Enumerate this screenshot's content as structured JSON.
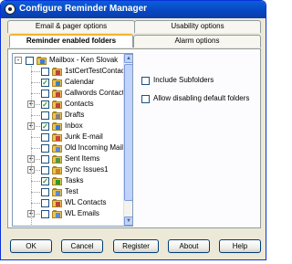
{
  "window": {
    "title": "Configure Reminder Manager",
    "titlebar_color": "#0a53d0"
  },
  "tabs": {
    "row_back": [
      {
        "label": "Email & pager options"
      },
      {
        "label": "Usability options"
      }
    ],
    "row_front": [
      {
        "label": "Reminder enabled folders",
        "active": true
      },
      {
        "label": "Alarm options",
        "active": false
      }
    ]
  },
  "tree": {
    "nodes": [
      {
        "label": "Mailbox - Ken Slovak",
        "checked": false,
        "expander": "-",
        "icon": "mailbox-icon"
      },
      {
        "label": "1stCertTestContac",
        "checked": false,
        "icon": "contacts-folder-icon"
      },
      {
        "label": "Calendar",
        "checked": true,
        "icon": "calendar-folder-icon"
      },
      {
        "label": "Callwords Contacts",
        "checked": false,
        "icon": "contacts-folder-icon"
      },
      {
        "label": "Contacts",
        "checked": true,
        "expander": "+",
        "icon": "contacts-folder-icon"
      },
      {
        "label": "Drafts",
        "checked": false,
        "icon": "drafts-folder-icon"
      },
      {
        "label": "Inbox",
        "checked": true,
        "expander": "+",
        "icon": "inbox-folder-icon"
      },
      {
        "label": "Junk E-mail",
        "checked": false,
        "icon": "junk-folder-icon"
      },
      {
        "label": "Old Incoming Mail",
        "checked": false,
        "icon": "mail-folder-icon"
      },
      {
        "label": "Sent Items",
        "checked": false,
        "expander": "+",
        "icon": "sent-folder-icon"
      },
      {
        "label": "Sync Issues1",
        "checked": false,
        "expander": "+",
        "icon": "sync-folder-icon"
      },
      {
        "label": "Tasks",
        "checked": true,
        "icon": "tasks-folder-icon"
      },
      {
        "label": "Test",
        "checked": false,
        "icon": "mail-folder-icon"
      },
      {
        "label": "WL Contacts",
        "checked": false,
        "icon": "contacts-folder-icon"
      },
      {
        "label": "WL Emails",
        "checked": false,
        "expander": "+",
        "icon": "mail-folder-icon"
      }
    ]
  },
  "options": [
    {
      "label": "Include Subfolders",
      "checked": false
    },
    {
      "label": "Allow disabling default folders",
      "checked": false
    }
  ],
  "buttons": {
    "ok": "OK",
    "cancel": "Cancel",
    "register": "Register",
    "about": "About",
    "help": "Help"
  }
}
